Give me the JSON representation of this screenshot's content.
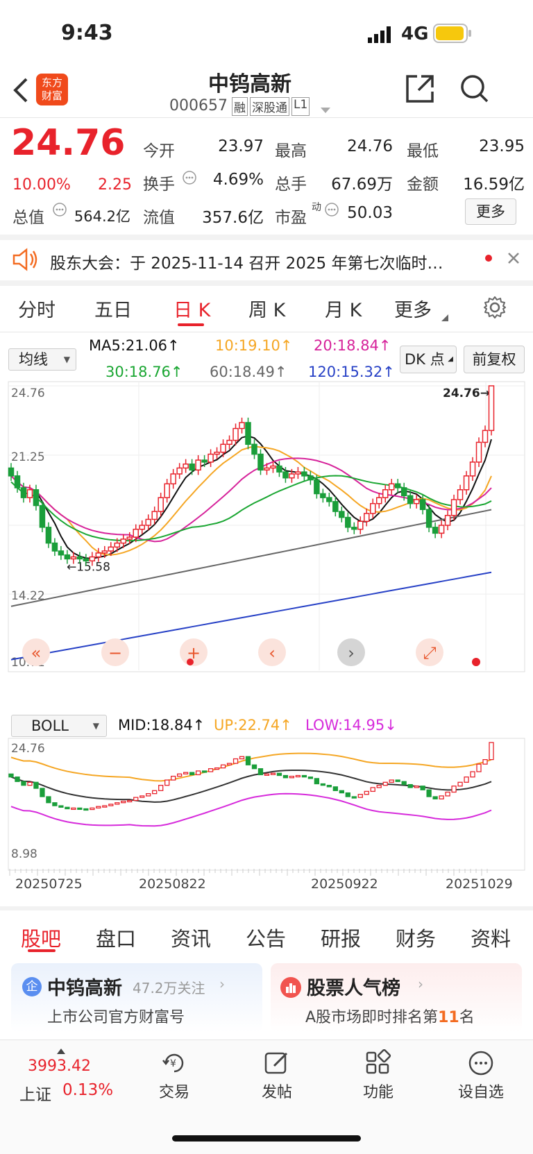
{
  "status_bar": {
    "time": "9:43",
    "network": "4G"
  },
  "header": {
    "title": "中钨高新",
    "code": "000657",
    "badges": [
      "融",
      "深股通",
      "L1"
    ]
  },
  "quote": {
    "price": "24.76",
    "pct": "10.00%",
    "change": "2.25",
    "fields": [
      {
        "label": "今开",
        "value": "23.97"
      },
      {
        "label": "最高",
        "value": "24.76"
      },
      {
        "label": "最低",
        "value": "23.95"
      },
      {
        "label": "换手",
        "value": "4.69%"
      },
      {
        "label": "总手",
        "value": "67.69万"
      },
      {
        "label": "金额",
        "value": "16.59亿"
      },
      {
        "label": "总值",
        "value": "564.2亿"
      },
      {
        "label": "流值",
        "value": "357.6亿"
      },
      {
        "label": "市盈",
        "value": "50.03",
        "sup": "动"
      }
    ],
    "more": "更多"
  },
  "notice": {
    "text": "股东大会：于 2025-11-14 召开 2025 年第七次临时…"
  },
  "tabs": [
    "分时",
    "五日",
    "日 K",
    "周 K",
    "月 K",
    "更多"
  ],
  "ma": {
    "selector": "均线",
    "ma5": "MA5:21.06↑",
    "ma10": "10:19.10↑",
    "ma20": "20:18.84↑",
    "ma30": "30:18.76↑",
    "ma60": "60:18.49↑",
    "ma120": "120:15.32↑",
    "dk": "DK 点",
    "adjust": "前复权"
  },
  "boll": {
    "selector": "BOLL",
    "mid": "MID:18.84↑",
    "up": "UP:22.74↑",
    "low": "LOW:14.95↓"
  },
  "chart_data": [
    {
      "type": "candlestick",
      "ylim": [
        10.71,
        24.76
      ],
      "ticks": [
        "24.76",
        "21.25",
        "14.22",
        "10.71"
      ],
      "high_label": "24.76→",
      "low_label": "←15.58",
      "closes": [
        20.2,
        19.6,
        19.1,
        19.5,
        18.7,
        17.6,
        16.8,
        16.4,
        16.2,
        16.0,
        16.1,
        16.0,
        15.9,
        16.1,
        16.3,
        16.4,
        16.6,
        16.8,
        17.0,
        17.1,
        17.5,
        17.7,
        18.0,
        18.4,
        19.1,
        19.8,
        20.3,
        20.6,
        20.8,
        20.5,
        21.0,
        20.9,
        21.3,
        21.4,
        21.8,
        22.0,
        22.6,
        22.9,
        21.8,
        21.3,
        20.5,
        20.6,
        20.7,
        20.4,
        20.1,
        20.3,
        20.4,
        20.2,
        20.0,
        19.3,
        19.1,
        18.9,
        18.4,
        18.1,
        17.6,
        17.5,
        17.9,
        18.3,
        18.8,
        19.1,
        19.5,
        19.8,
        19.6,
        19.2,
        18.8,
        19.0,
        18.5,
        17.6,
        17.3,
        17.7,
        18.2,
        19.0,
        19.5,
        20.2,
        20.9,
        21.9,
        22.5,
        24.76
      ],
      "series": [
        {
          "name": "MA5"
        },
        {
          "name": "MA10"
        },
        {
          "name": "MA20"
        },
        {
          "name": "MA30"
        },
        {
          "name": "MA60"
        },
        {
          "name": "MA120"
        }
      ]
    },
    {
      "type": "candlestick",
      "ylim": [
        8.98,
        24.76
      ],
      "ticks": [
        "24.76",
        "8.98"
      ],
      "series": [
        {
          "name": "MID"
        },
        {
          "name": "UP"
        },
        {
          "name": "LOW"
        }
      ]
    }
  ],
  "dates": [
    "20250725",
    "20250822",
    "20250922",
    "20251029"
  ],
  "bottom_tabs": [
    "股吧",
    "盘口",
    "资讯",
    "公告",
    "研报",
    "财务",
    "资料"
  ],
  "cards": [
    {
      "title": "中钨高新",
      "sub": "47.2万关注",
      "desc": "上市公司官方财富号"
    },
    {
      "title": "股票人气榜",
      "desc": "A股市场即时排名第",
      "rank": "11",
      "suffix": "名"
    }
  ],
  "index": {
    "value": "3993.42",
    "name": "上证",
    "pct": "0.13%"
  },
  "nav": [
    "交易",
    "发帖",
    "功能",
    "设自选"
  ],
  "colors": {
    "up": "#e8222b",
    "down": "#1a9e3a",
    "ma5": "#111111",
    "ma10": "#f5a623",
    "ma20": "#d6229a",
    "ma30": "#1aa632",
    "ma60": "#666666",
    "ma120": "#2741c6"
  }
}
